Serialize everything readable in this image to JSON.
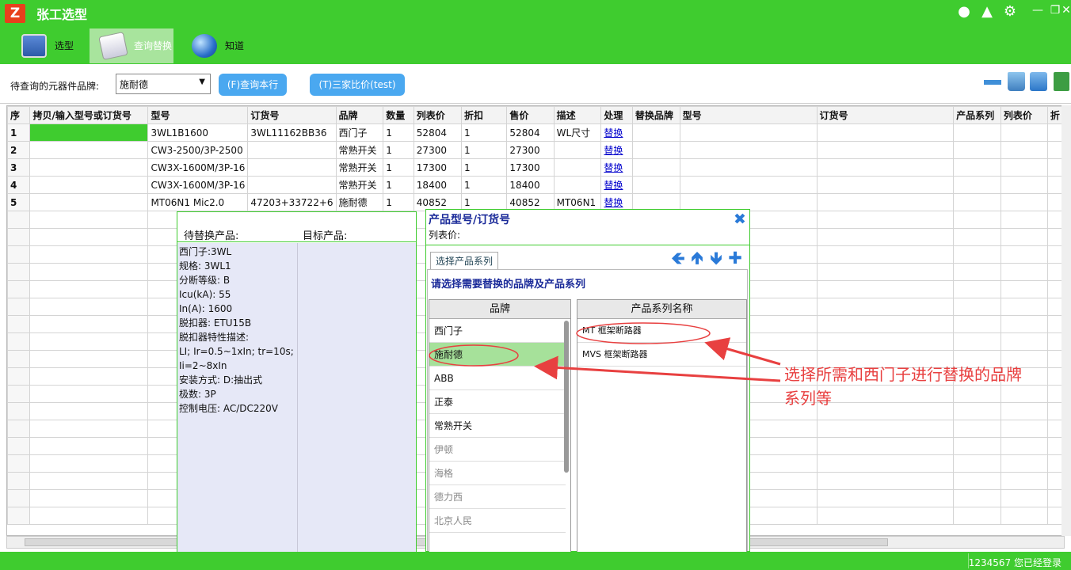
{
  "app": {
    "title": "张工选型",
    "logo_glyph": "Z"
  },
  "window_controls": {
    "minimize": "—",
    "restore": "❐",
    "close": "✕"
  },
  "title_icons": [
    "user-icon",
    "qq-icon",
    "gear-icon"
  ],
  "tabs": [
    {
      "label": "选型",
      "icon": "monitor-icon",
      "active": false
    },
    {
      "label": "查询替换",
      "icon": "document-icon",
      "active": true
    },
    {
      "label": "知道",
      "icon": "globe-icon",
      "active": false
    }
  ],
  "search": {
    "label": "待查询的元器件品牌:",
    "brand_value": "施耐德",
    "query_button": "(F)查询本行",
    "compare_button": "(T)三家比价(test)"
  },
  "table": {
    "columns": [
      "序",
      "拷贝/输入型号或订货号",
      "型号",
      "订货号",
      "品牌",
      "数量",
      "列表价",
      "折扣",
      "售价",
      "描述",
      "处理",
      "替换品牌",
      "型号",
      "订货号",
      "产品系列",
      "列表价",
      "折"
    ],
    "rows": [
      {
        "seq": "1",
        "input": "",
        "model": "3WL1B1600",
        "order_no": "3WL11162BB36",
        "brand": "西门子",
        "qty": "1",
        "list_price": "52804",
        "discount": "1",
        "price": "52804",
        "desc": "WL尺寸",
        "action": "替换"
      },
      {
        "seq": "2",
        "input": "",
        "model": "CW3-2500/3P-2500",
        "order_no": "",
        "brand": "常熟开关",
        "qty": "1",
        "list_price": "27300",
        "discount": "1",
        "price": "27300",
        "desc": "",
        "action": "替换"
      },
      {
        "seq": "3",
        "input": "",
        "model": "CW3X-1600M/3P-16",
        "order_no": "",
        "brand": "常熟开关",
        "qty": "1",
        "list_price": "17300",
        "discount": "1",
        "price": "17300",
        "desc": "",
        "action": "替换"
      },
      {
        "seq": "4",
        "input": "",
        "model": "CW3X-1600M/3P-16",
        "order_no": "",
        "brand": "常熟开关",
        "qty": "1",
        "list_price": "18400",
        "discount": "1",
        "price": "18400",
        "desc": "",
        "action": "替换"
      },
      {
        "seq": "5",
        "input": "",
        "model": "MT06N1 Mic2.0",
        "order_no": "47203+33722+6",
        "brand": "施耐德",
        "qty": "1",
        "list_price": "40852",
        "discount": "1",
        "price": "40852",
        "desc": "MT06N1",
        "action": "替换"
      }
    ]
  },
  "replace_panel": {
    "header_left": "待替换产品:",
    "header_right": "目标产品:",
    "specs": [
      "西门子:3WL",
      "规格: 3WL1",
      "分断等级: B",
      "Icu(kA): 55",
      "In(A): 1600",
      "脱扣器: ETU15B",
      "脱扣器特性描述:",
      "LI; Ir=0.5~1xIn; tr=10s;",
      "Ii=2~8xIn",
      "安装方式: D:抽出式",
      "极数: 3P",
      "控制电压: AC/DC220V"
    ]
  },
  "product_panel": {
    "title": "产品型号/订货号",
    "list_price_label": "列表价:",
    "tab_label": "选择产品系列",
    "prompt": "请选择需要替换的品牌及产品系列",
    "brand_header": "品牌",
    "series_header": "产品系列名称",
    "brands": [
      "西门子",
      "施耐德",
      "ABB",
      "正泰",
      "常熟开关",
      "伊顿",
      "海格",
      "德力西",
      "北京人民"
    ],
    "selected_brand": "施耐德",
    "series": [
      "MT 框架断路器",
      "MVS 框架断路器"
    ],
    "nav_icons": [
      "arrow-left-icon",
      "arrow-up-icon",
      "arrow-down-icon",
      "plus-icon"
    ]
  },
  "annotation": {
    "line1": "选择所需和西门子进行替换的品牌",
    "line2": "系列等",
    "color": "#e84040"
  },
  "status": {
    "text": "1234567 您已经登录"
  },
  "colors": {
    "accent_green": "#3fcc2f",
    "button_blue": "#4aa8f0",
    "title_blue": "#1a2a99"
  }
}
